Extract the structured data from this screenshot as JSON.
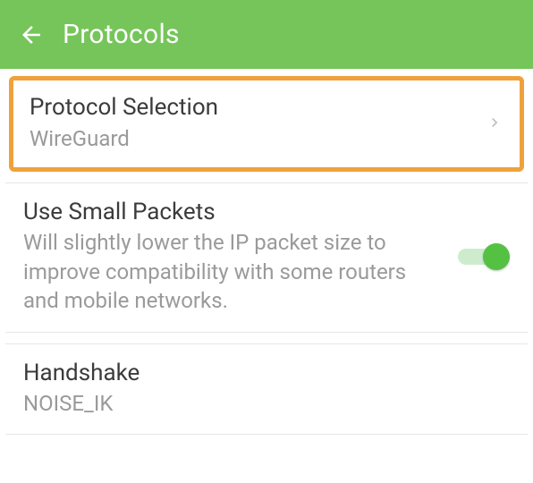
{
  "appbar": {
    "title": "Protocols"
  },
  "rows": {
    "protocol_selection": {
      "title": "Protocol Selection",
      "value": "WireGuard"
    },
    "small_packets": {
      "title": "Use Small Packets",
      "description": "Will slightly lower the IP packet size to improve compatibility with some routers and mobile networks.",
      "enabled": true
    },
    "handshake": {
      "title": "Handshake",
      "value": "NOISE_IK"
    }
  },
  "colors": {
    "accent": "#76c55a",
    "highlight_border": "#efa23b",
    "switch_thumb": "#55c143"
  }
}
